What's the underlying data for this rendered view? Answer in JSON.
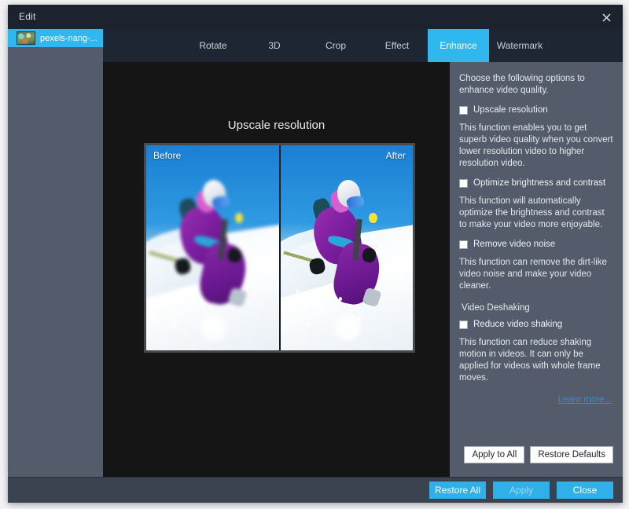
{
  "window": {
    "title": "Edit",
    "close_icon": "close-icon"
  },
  "sidebar": {
    "files": [
      {
        "name": "pexels-nang-...",
        "selected": true
      }
    ]
  },
  "tabs": [
    {
      "label": "Rotate",
      "active": false
    },
    {
      "label": "3D",
      "active": false
    },
    {
      "label": "Crop",
      "active": false
    },
    {
      "label": "Effect",
      "active": false
    },
    {
      "label": "Enhance",
      "active": true
    },
    {
      "label": "Watermark",
      "active": false
    }
  ],
  "preview": {
    "title": "Upscale resolution",
    "before_label": "Before",
    "after_label": "After"
  },
  "options": {
    "intro": "Choose the following options to enhance video quality.",
    "items": [
      {
        "label": "Upscale resolution",
        "checked": false,
        "description": "This function enables you to get superb video quality when you convert lower resolution video to higher resolution video."
      },
      {
        "label": "Optimize brightness and contrast",
        "checked": false,
        "description": "This function will automatically optimize the brightness and contrast to make your video more enjoyable."
      },
      {
        "label": "Remove video noise",
        "checked": false,
        "description": "This function can remove the dirt-like video noise and make your video cleaner."
      }
    ],
    "group_label": "Video Deshaking",
    "deshake": {
      "label": "Reduce video shaking",
      "checked": false,
      "description": "This function can reduce shaking motion in videos. It can only be applied for videos with whole frame moves."
    },
    "learn_more": "Learn more...",
    "apply_to_all_label": "Apply to All",
    "restore_defaults_label": "Restore Defaults"
  },
  "footer": {
    "restore_all_label": "Restore All",
    "apply_label": "Apply",
    "close_label": "Close"
  },
  "colors": {
    "accent": "#2fb8f0",
    "panel": "#545c6b",
    "titlebar": "#1d232e",
    "tabbar": "#1f2633",
    "footer": "#3c4350",
    "link": "#2f8fd8"
  }
}
